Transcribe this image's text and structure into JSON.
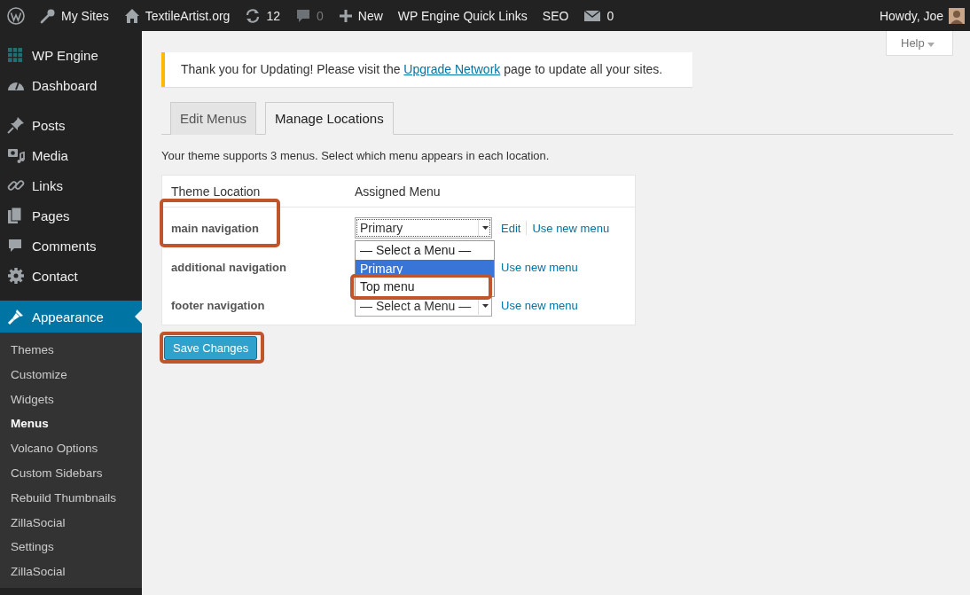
{
  "admin_bar": {
    "items": [
      {
        "label": "My Sites"
      },
      {
        "label": "TextileArtist.org"
      },
      {
        "label": "12",
        "disabled": false
      },
      {
        "label": "0",
        "disabled": true
      },
      {
        "label": "New"
      },
      {
        "label": "WP Engine Quick Links"
      },
      {
        "label": "SEO"
      },
      {
        "label": "0",
        "disabled": false
      }
    ],
    "greeting": "Howdy, Joe"
  },
  "sidebar": {
    "groups": [
      {
        "items": [
          {
            "label": "WP Engine",
            "selected": false
          },
          {
            "label": "Dashboard",
            "selected": false
          }
        ]
      },
      {
        "items": [
          {
            "label": "Posts",
            "selected": false
          },
          {
            "label": "Media",
            "selected": false
          },
          {
            "label": "Links",
            "selected": false
          },
          {
            "label": "Pages",
            "selected": false
          },
          {
            "label": "Comments",
            "selected": false
          },
          {
            "label": "Contact",
            "selected": false
          }
        ]
      },
      {
        "items": [
          {
            "label": "Appearance",
            "selected": true,
            "children": [
              {
                "label": "Themes",
                "selected": false
              },
              {
                "label": "Customize",
                "selected": false
              },
              {
                "label": "Widgets",
                "selected": false
              },
              {
                "label": "Menus",
                "selected": true
              },
              {
                "label": "Volcano Options",
                "selected": false
              },
              {
                "label": "Custom Sidebars",
                "selected": false
              },
              {
                "label": "Rebuild Thumbnails",
                "selected": false
              },
              {
                "label": "ZillaSocial",
                "selected": false
              },
              {
                "label": "Settings",
                "selected": false
              },
              {
                "label": "ZillaSocial",
                "selected": false
              }
            ]
          }
        ]
      }
    ]
  },
  "help_tab": "Help",
  "notice": {
    "before": "Thank you for Updating! Please visit the ",
    "link": "Upgrade Network",
    "after": " page to update all your sites."
  },
  "tabs": [
    {
      "label": "Edit Menus",
      "selected": false
    },
    {
      "label": "Manage Locations",
      "selected": true
    }
  ],
  "description": "Your theme supports 3 menus. Select which menu appears in each location.",
  "table": {
    "columns": [
      "Theme Location",
      "Assigned Menu"
    ],
    "rows": [
      {
        "location": "main navigation",
        "highlighted": true,
        "menu": "Primary",
        "links": [
          "Edit",
          "Use new menu"
        ],
        "expanded": true,
        "options": [
          {
            "label": "— Select a Menu —",
            "selected": false,
            "highlighted": false
          },
          {
            "label": "Primary",
            "selected": true,
            "highlighted": false
          },
          {
            "label": "Top menu",
            "selected": false,
            "highlighted": true
          }
        ]
      },
      {
        "location": "additional navigation",
        "highlighted": false,
        "links": [
          "Use new menu"
        ]
      },
      {
        "location": "footer navigation",
        "highlighted": false,
        "menu": "— Select a Menu —",
        "links": [
          "Use new menu"
        ]
      }
    ]
  },
  "save_button": {
    "label": "Save Changes",
    "highlighted": true
  }
}
